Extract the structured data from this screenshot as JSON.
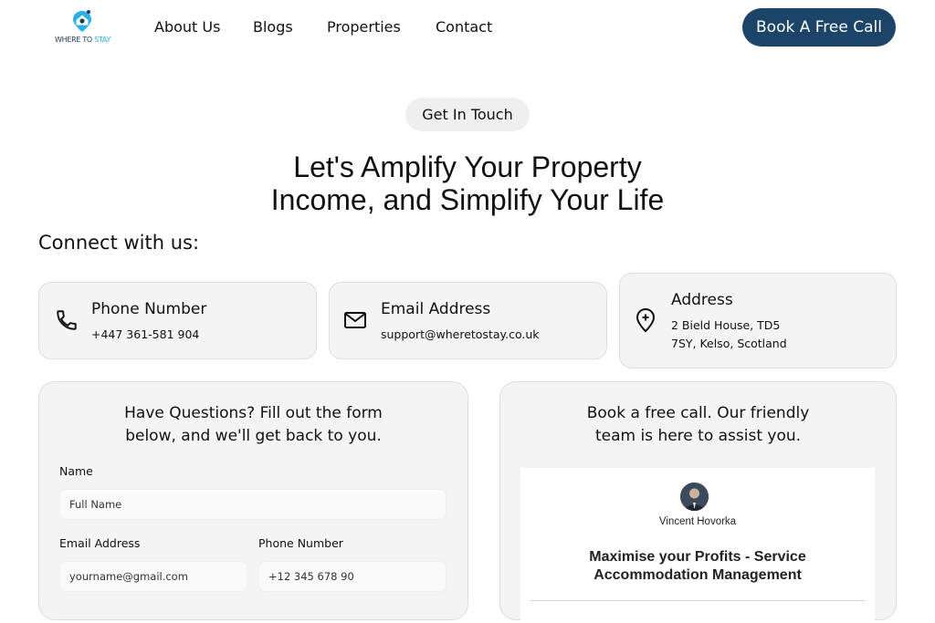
{
  "nav": {
    "logo_text_1": "WHERE TO ",
    "logo_text_2": "STAY",
    "links": [
      "About Us",
      "Blogs",
      "Properties",
      "Contact"
    ],
    "cta": "Book A Free Call"
  },
  "hero": {
    "pill": "Get In Touch",
    "title_line1": "Let's Amplify Your Property",
    "title_line2": "Income, and Simplify Your Life"
  },
  "connect_heading": "Connect with us:",
  "contact_cards": {
    "phone": {
      "title": "Phone Number",
      "value": "+447 361-581 904",
      "icon": "phone-icon"
    },
    "email": {
      "title": "Email Address",
      "value": "support@wheretostay.co.uk",
      "icon": "mail-icon"
    },
    "address": {
      "title": "Address",
      "line1": "2 Bield House, TD5",
      "line2": "7SY, Kelso, Scotland",
      "icon": "location-pin-icon"
    }
  },
  "form": {
    "heading_line1": "Have Questions? Fill out the form",
    "heading_line2": "below, and we'll get back to you.",
    "name_label": "Name",
    "name_placeholder": "Full Name",
    "email_label": "Email Address",
    "email_placeholder": "yourname@gmail.com",
    "phone_label": "Phone Number",
    "phone_placeholder": "+12 345 678 90"
  },
  "booking": {
    "heading_line1": "Book a free call. Our friendly",
    "heading_line2": "team is here to assist you.",
    "host_name": "Vincent Hovorka",
    "event_title": "Maximise your Profits - Service Accommodation Management"
  },
  "colors": {
    "brand_navy": "#1b4468",
    "logo_blue": "#2bb0e6",
    "card_bg": "#f4f4f4"
  }
}
